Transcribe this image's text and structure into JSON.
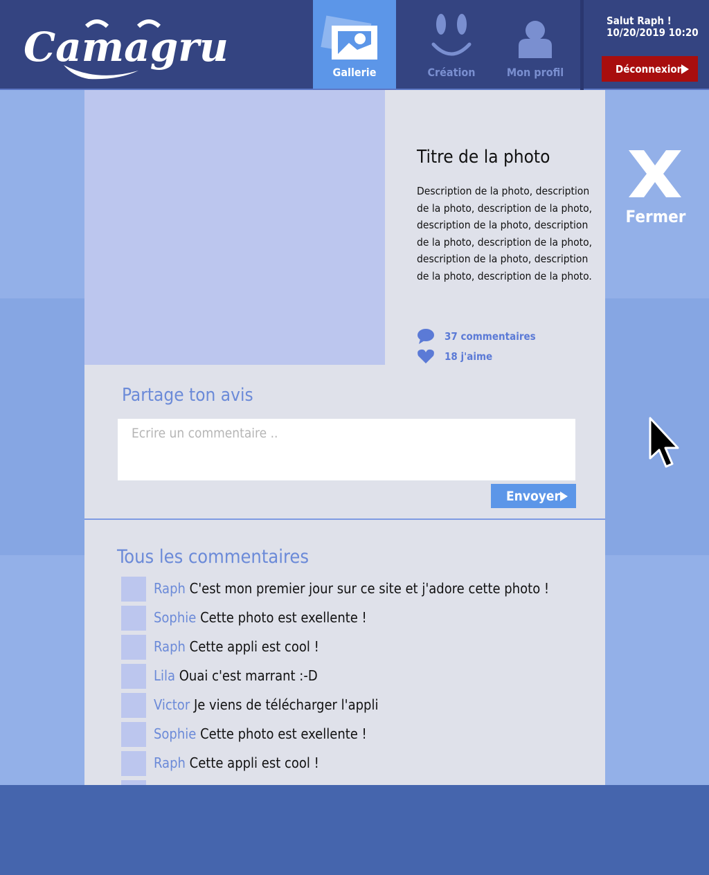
{
  "app": {
    "logo_text": "Camagru"
  },
  "nav": {
    "items": [
      {
        "label": "Gallerie",
        "icon": "gallery-photo-icon",
        "active": true
      },
      {
        "label": "Création",
        "icon": "smiley-face-icon",
        "active": false
      },
      {
        "label": "Mon profil",
        "icon": "user-profile-icon",
        "active": false
      }
    ]
  },
  "user": {
    "greeting": "Salut Raph !",
    "datetime": "10/20/2019 10:20",
    "logout_label": "Déconnexion"
  },
  "photo": {
    "title": "Titre de la photo",
    "description": "Description de la photo, description de la photo, description de la photo, description de la photo, description de la photo, description de la photo, description de la photo, description de la photo, description de la photo.",
    "comments_count": "37 commentaires",
    "likes_count": "18 j'aime"
  },
  "share": {
    "title": "Partage ton avis",
    "placeholder": "Ecrire un commentaire ..",
    "send_label": "Envoyer"
  },
  "comments": {
    "title": "Tous les commentaires",
    "items": [
      {
        "author": "Raph",
        "text": "C'est mon premier jour sur ce site et j'adore cette photo !"
      },
      {
        "author": "Sophie",
        "text": "Cette photo est exellente !"
      },
      {
        "author": "Raph",
        "text": "Cette appli est cool !"
      },
      {
        "author": "Lila",
        "text": "Ouai c'est marrant :-D"
      },
      {
        "author": "Victor",
        "text": "Je viens de télécharger l'appli"
      },
      {
        "author": "Sophie",
        "text": "Cette photo est exellente !"
      },
      {
        "author": "Raph",
        "text": "Cette appli est cool !"
      },
      {
        "author": "",
        "text": ""
      }
    ]
  },
  "close": {
    "label": "Fermer"
  },
  "colors": {
    "header_bg": "#344481",
    "active_nav": "#5c96e8",
    "logout_bg": "#a80e0e",
    "accent_text": "#6b8ad8",
    "panel_bg": "#dfe1ea",
    "photo_placeholder": "#bcc6ee"
  }
}
